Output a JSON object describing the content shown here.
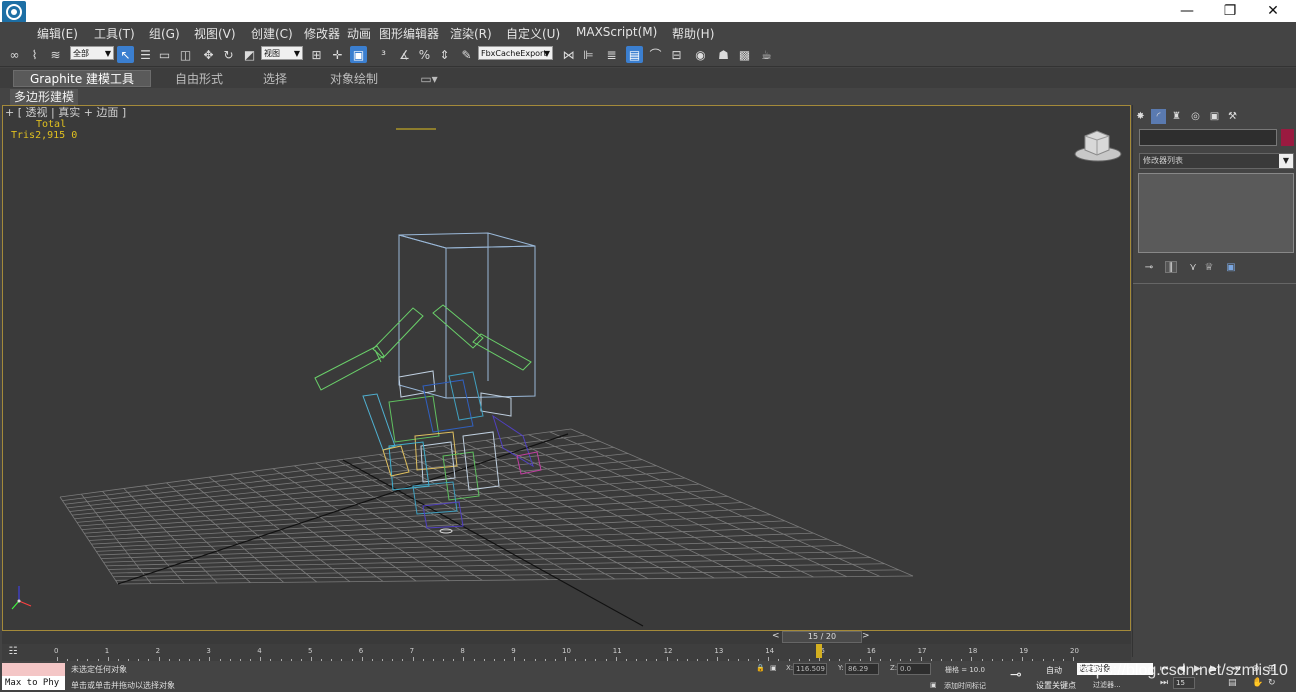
{
  "window": {
    "minimize_glyph": "—",
    "restore_glyph": "❐",
    "close_glyph": "✕"
  },
  "menu": [
    "编辑(E)",
    "工具(T)",
    "组(G)",
    "视图(V)",
    "创建(C)",
    "修改器",
    "动画",
    "图形编辑器",
    "渲染(R)",
    "自定义(U)",
    "MAXScript(M)",
    "帮助(H)"
  ],
  "toolbar": {
    "selection_filter": "全部",
    "ref_coord": "视图",
    "named_selection": "FbxCacheExport"
  },
  "ribbon": {
    "tabs": [
      "Graphite 建模工具",
      "自由形式",
      "选择",
      "对象绘制"
    ],
    "panel_label": "多边形建模"
  },
  "viewport": {
    "header": "+ [ 透视 | 真实 + 边面 ]",
    "stats_header": "Total",
    "stats_tris": "Tris2,915 0"
  },
  "command_panel": {
    "modifier_list": "修改器列表"
  },
  "timeline": {
    "frame_display": "15 / 20",
    "prev_arrow": "<",
    "next_arrow": ">",
    "ticks": [
      "0",
      "1",
      "2",
      "3",
      "4",
      "5",
      "6",
      "7",
      "8",
      "9",
      "10",
      "11",
      "12",
      "13",
      "14",
      "15",
      "16",
      "17",
      "18",
      "19",
      "20"
    ],
    "current_frame": 15
  },
  "status": {
    "line1": "未选定任何对象",
    "line2": "单击或单击并拖动以选择对象",
    "maxscript_text": "Max to Phy",
    "x_label": "X:",
    "x_value": "116.509",
    "y_label": "Y:",
    "y_value": "86.29",
    "z_label": "Z:",
    "z_value": "0.0",
    "grid": "栅格 = 10.0",
    "add_time_tag": "添加时间标记",
    "auto_key": "自动",
    "set_key": "设置关键点",
    "key_filter": "选定对象",
    "filters": "过滤器...",
    "frame_spinner": "15"
  },
  "watermark": "https://blog.csdn.net/szmlis10"
}
